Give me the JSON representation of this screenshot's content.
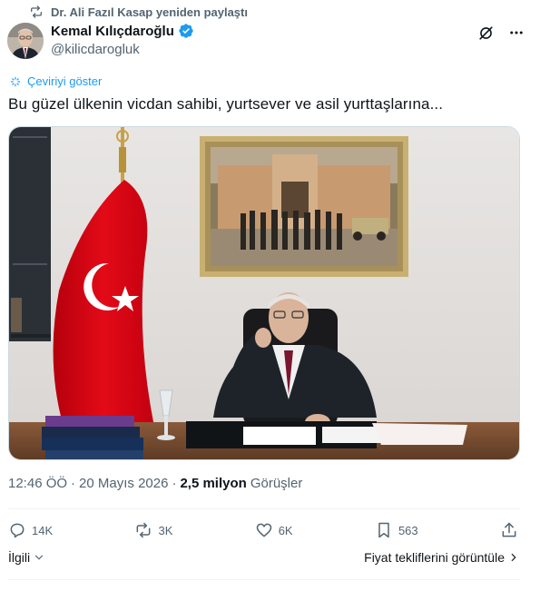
{
  "repost": {
    "text": "Dr. Ali Fazıl Kasap yeniden paylaştı",
    "icon": "repost-icon"
  },
  "author": {
    "name": "Kemal Kılıçdaroğlu",
    "handle": "@kilicdarogluk",
    "verified_color": "#1d9bf0"
  },
  "translate": {
    "label": "Çeviriyi göster"
  },
  "tweet": {
    "text": "Bu güzel ülkenin vicdan sahibi, yurtsever ve asil yurttaşlarına..."
  },
  "meta": {
    "time": "12:46 ÖÖ",
    "dot": "·",
    "date": "20 Mayıs 2026",
    "views_value": "2,5 milyon",
    "views_label": "Görüşler"
  },
  "actions": {
    "replies": "14K",
    "reposts": "3K",
    "likes": "6K",
    "bookmarks": "563"
  },
  "bottom": {
    "related": "İlgili",
    "offers": "Fiyat tekliflerini görüntüle"
  },
  "colors": {
    "accent": "#1d9bf0",
    "muted": "#536471",
    "text": "#0f1419",
    "flag_red": "#e30a17"
  }
}
